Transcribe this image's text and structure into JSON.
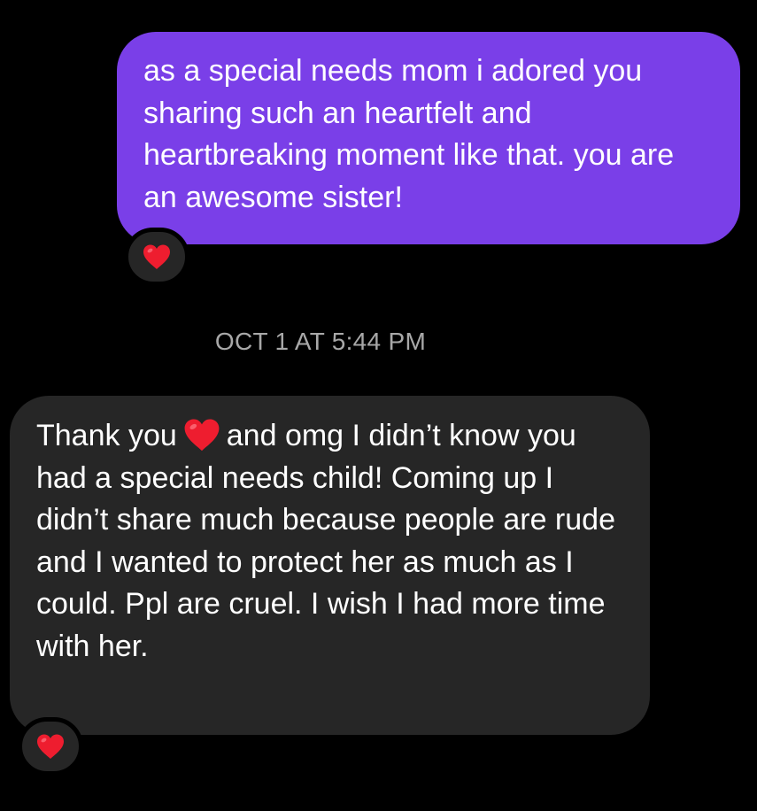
{
  "conversation": {
    "sent_message": {
      "text": "as a special needs mom i adored you sharing such an heartfelt and heartbreaking moment like that. you are an awesome sister!",
      "reaction": "heart-icon"
    },
    "timestamp": "OCT 1 AT 5:44 PM",
    "received_message": {
      "text_before_heart": "Thank you",
      "text_after_heart": "and omg I didn’t know you had a special needs child! Coming up I didn’t share much because people are rude and I wanted to protect her as much as I could. Ppl are cruel. I wish I had more time with her.",
      "reaction": "heart-icon"
    }
  },
  "colors": {
    "background": "#000000",
    "sent_bubble": "#7a3fe8",
    "received_bubble": "#262626",
    "timestamp": "#a8a8a8",
    "heart": "#ee1d2f"
  }
}
